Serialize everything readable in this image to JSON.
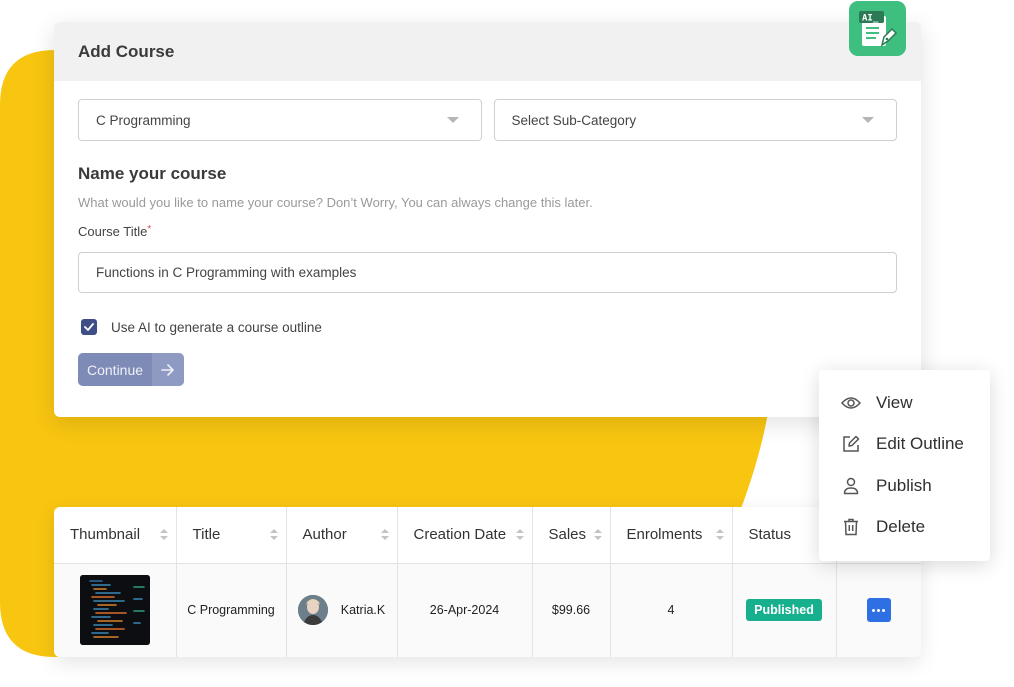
{
  "card": {
    "title": "Add Course",
    "category_select": {
      "value": "C Programming"
    },
    "subcategory_select": {
      "value": "Select Sub-Category"
    },
    "section_title": "Name your course",
    "section_desc": "What would you like to name your course? Don’t Worry, You can always change this later.",
    "course_title_label": "Course Title",
    "required_mark": "*",
    "course_title_value": "Functions in C Programming with examples",
    "ai_checkbox": {
      "label": "Use AI to generate a course outline",
      "checked": true
    },
    "continue_label": "Continue",
    "continue_icon": "arrow-right-icon"
  },
  "ai_badge": {
    "text": "AI_",
    "icon": "ai-document-pen-icon",
    "color": "#3fbf7f"
  },
  "menu": {
    "items": [
      {
        "label": "View",
        "icon": "eye-icon"
      },
      {
        "label": "Edit Outline",
        "icon": "edit-icon"
      },
      {
        "label": "Publish",
        "icon": "user-icon"
      },
      {
        "label": "Delete",
        "icon": "trash-icon"
      }
    ]
  },
  "table": {
    "columns": [
      {
        "label": "Thumbnail",
        "sortable": true
      },
      {
        "label": "Title",
        "sortable": true
      },
      {
        "label": "Author",
        "sortable": true
      },
      {
        "label": "Creation Date",
        "sortable": true
      },
      {
        "label": "Sales",
        "sortable": true
      },
      {
        "label": "Enrolments",
        "sortable": true
      },
      {
        "label": "Status",
        "sortable": false
      },
      {
        "label": "",
        "sortable": false
      }
    ],
    "rows": [
      {
        "thumbnail": "code-screenshot",
        "title": "C Programming",
        "author": "Katria.K",
        "creation_date": "26-Apr-2024",
        "sales": "$99.66",
        "enrolments": "4",
        "status": "Published"
      }
    ]
  },
  "colors": {
    "accent_yellow": "#f8c511",
    "status_published": "#17b08e",
    "more_button": "#2f6fe4",
    "checkbox": "#3f4e86",
    "continue_button": "#8591bb"
  }
}
